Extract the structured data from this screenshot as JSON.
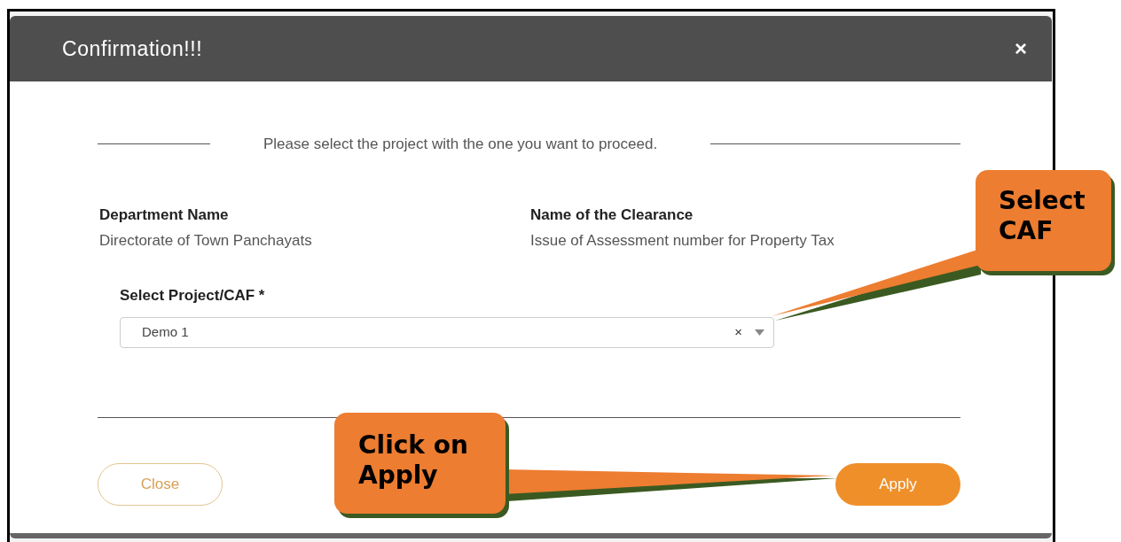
{
  "modal": {
    "title": "Confirmation!!!",
    "close_symbol": "×",
    "instruction": "Please select the project with the one you want to proceed.",
    "fields": [
      {
        "label": "Department Name",
        "value": "Directorate of Town Panchayats"
      },
      {
        "label": "Name of the Clearance",
        "value": "Issue of Assessment number for Property Tax"
      }
    ],
    "select": {
      "label": "Select Project/CAF *",
      "value": "Demo 1",
      "clear_symbol": "×"
    },
    "buttons": [
      {
        "label": "Close",
        "kind": "secondary"
      },
      {
        "label": "Apply",
        "kind": "primary"
      }
    ]
  },
  "callouts": [
    {
      "text": "Select CAF",
      "kind": "select"
    },
    {
      "text": "Click on Apply",
      "kind": "apply"
    }
  ]
}
